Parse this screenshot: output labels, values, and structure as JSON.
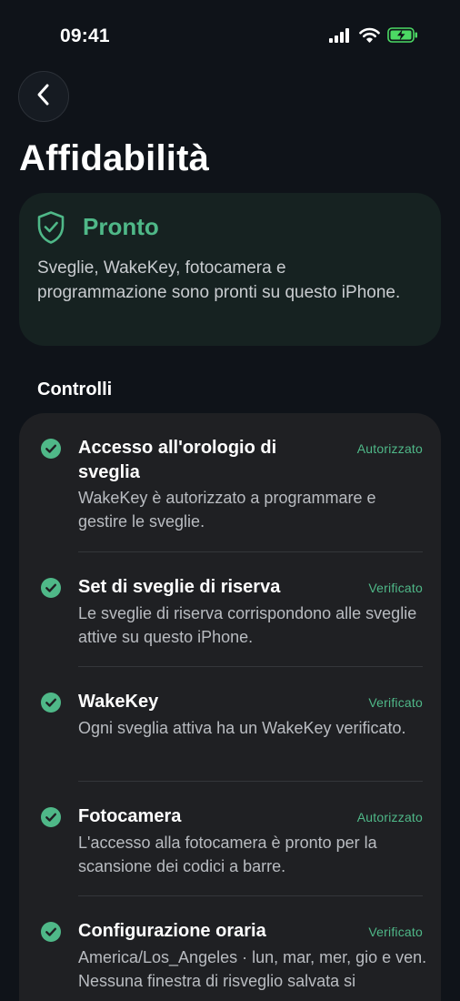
{
  "status_bar": {
    "time": "09:41",
    "icons": [
      "cellular-signal-icon",
      "wifi-icon",
      "battery-charging-icon"
    ],
    "battery_color": "#4cd964"
  },
  "nav": {
    "back_icon": "chevron-left-icon"
  },
  "page_title": "Affidabilità",
  "ready_card": {
    "icon": "shield-check-icon",
    "title": "Pronto",
    "description": "Sveglie, WakeKey, fotocamera e programmazione sono pronti su questo iPhone."
  },
  "section_title": "Controlli",
  "checks": [
    {
      "title": "Accesso all'orologio di sveglia",
      "status": "Autorizzato",
      "description": "WakeKey è autorizzato a programmare e gestire le sveglie."
    },
    {
      "title": "Set di sveglie di riserva",
      "status": "Verificato",
      "description": "Le sveglie di riserva corrispondono alle sveglie attive su questo iPhone."
    },
    {
      "title": "WakeKey",
      "status": "Verificato",
      "description": "Ogni sveglia attiva ha un WakeKey verificato."
    },
    {
      "title": "Fotocamera",
      "status": "Autorizzato",
      "description": "L'accesso alla fotocamera è pronto per la scansione dei codici a barre."
    },
    {
      "title": "Configurazione oraria",
      "status": "Verificato",
      "description": "America/Los_Angeles · lun, mar, mer, gio e ven. Nessuna finestra di risveglio salvata si sovrappone."
    }
  ],
  "colors": {
    "background": "#0f1319",
    "accent_green": "#4fb888",
    "ready_card_bg": "#162221",
    "checks_card_bg": "#1f2023"
  }
}
